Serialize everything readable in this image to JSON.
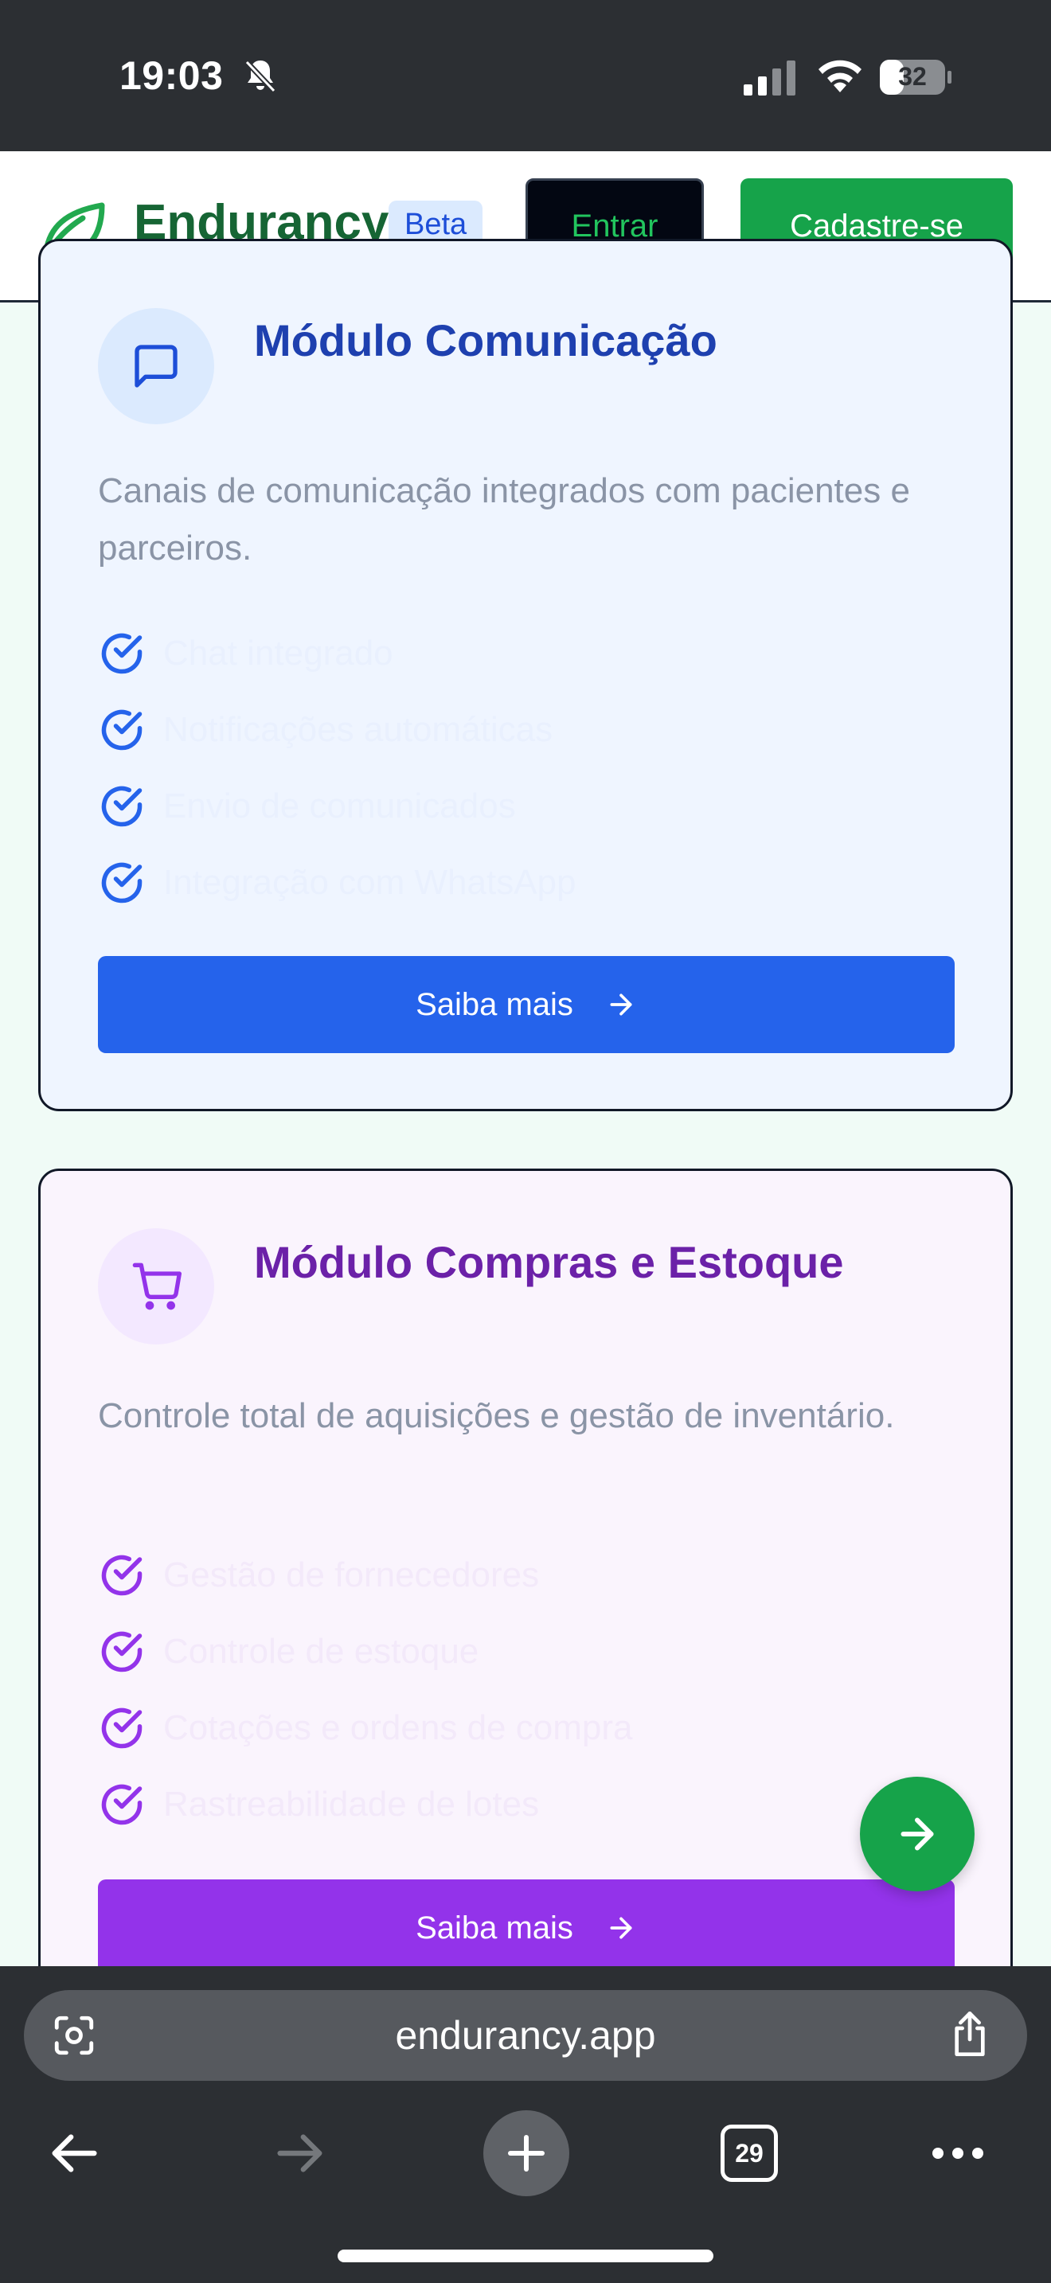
{
  "status_bar": {
    "time": "19:03",
    "battery_level": "32",
    "icons": [
      "bell-off-icon",
      "cellular-signal-icon",
      "wifi-icon",
      "battery-icon"
    ]
  },
  "header": {
    "logo_text": "Endurancy",
    "beta_badge": "Beta",
    "login_label": "Entrar",
    "signup_label": "Cadastre-se",
    "colors": {
      "brand": "#166534",
      "signup_bg": "#16a34a",
      "login_bg": "#030712"
    }
  },
  "modules": [
    {
      "title": "Módulo Comunicação",
      "description": "Canais de comunicação integrados com pacientes e parceiros.",
      "icon": "message-square-icon",
      "accent": "#2563eb",
      "features": [
        "Chat integrado",
        "Notificações automáticas",
        "Envio de comunicados",
        "Integração com WhatsApp"
      ],
      "button_label": "Saiba mais"
    },
    {
      "title": "Módulo Compras e Estoque",
      "description": "Controle total de aquisições e gestão de inventário.",
      "icon": "shopping-cart-icon",
      "accent": "#9333ea",
      "features": [
        "Gestão de fornecedores",
        "Controle de estoque",
        "Cotações e ordens de compra",
        "Rastreabilidade de lotes"
      ],
      "button_label": "Saiba mais"
    }
  ],
  "fab": {
    "icon": "arrow-right-icon"
  },
  "browser": {
    "url": "endurancy.app",
    "tab_count": "29",
    "icons": [
      "lens-icon",
      "share-icon",
      "back-arrow-icon",
      "forward-arrow-icon",
      "new-tab-plus-icon",
      "tabs-icon",
      "more-icon"
    ]
  }
}
